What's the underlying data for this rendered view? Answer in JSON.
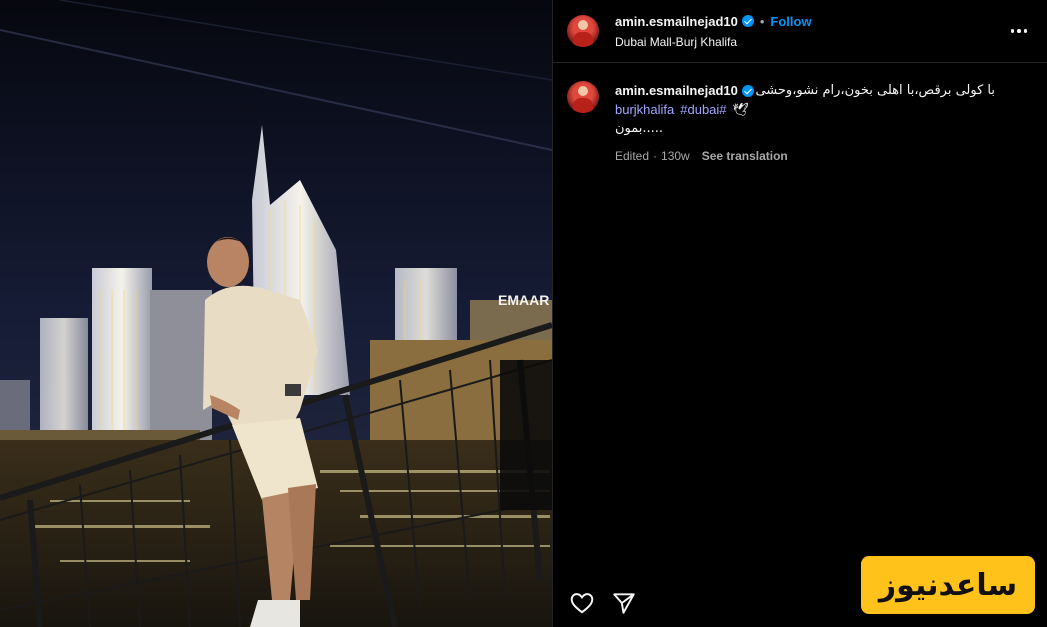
{
  "post": {
    "username": "amin.esmailnejad10",
    "follow_label": "Follow",
    "separator": "•",
    "location": "Dubai Mall-Burj Khalifa"
  },
  "caption": {
    "username": "amin.esmailnejad10",
    "text_line1": "با کولی برقص،با اهلی بخون،رام نشو،وحشی",
    "hashtags": [
      "burjkhalifa",
      "#dubai#"
    ],
    "text_line2": "بمون.....",
    "emoji": "🕊",
    "edited_label": "Edited",
    "separator": "·",
    "time": "130w",
    "see_translation": "See translation"
  },
  "photo": {
    "sign_text": "EMAAR",
    "tower_sign": "EMAAR"
  },
  "watermark": {
    "text": "ساعدنیوز"
  },
  "icons": {
    "like": "heart-icon",
    "share": "send-icon",
    "more": "more-options-icon",
    "verified": "verified-badge-icon"
  },
  "colors": {
    "accent": "#0095f6",
    "hashtag": "#a0a6ff",
    "watermark_bg": "#ffc21a"
  }
}
